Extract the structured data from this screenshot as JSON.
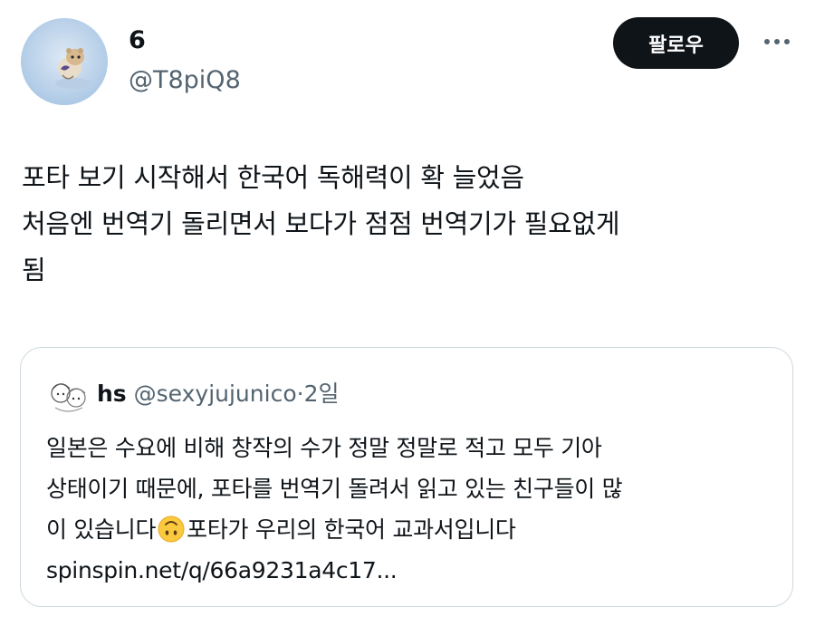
{
  "author": {
    "display_name": "6",
    "handle": "@T8piQ8"
  },
  "follow_button": {
    "label": "팔로우"
  },
  "more_menu": {
    "icon": "more-horizontal-icon"
  },
  "tweet": {
    "lines": [
      "포타 보기 시작해서 한국어 독해력이 확 늘었음",
      "처음엔 번역기 돌리면서 보다가 점점 번역기가 필요없게",
      "됨"
    ]
  },
  "quoted_tweet": {
    "display_name": "hs",
    "handle": "@sexyjujunico",
    "separator": "·",
    "time": "2일",
    "lines": [
      "일본은 수요에 비해 창작의 수가 정말 정말로 적고 모두 기아",
      "상태이기 때문에, 포타를 번역기 돌려서 읽고 있는 친구들이 많"
    ],
    "line3_before": "이 있습니다",
    "emoji": "upside-down-face-emoji",
    "line3_after": "포타가 우리의 한국어 교과서입니다",
    "link": "spinspin.net/q/66a9231a4c17..."
  },
  "colors": {
    "text": "#0f1419",
    "secondary": "#536471",
    "border": "#cfd9de",
    "follow_bg": "#0f1419",
    "emoji_yellow": "#fbc93d"
  }
}
